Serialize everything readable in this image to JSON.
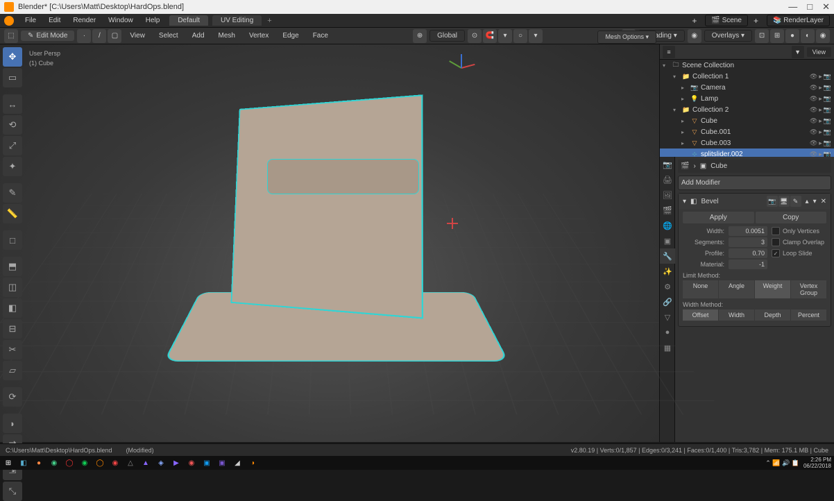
{
  "window": {
    "title": "Blender* [C:\\Users\\Matt\\Desktop\\HardOps.blend]",
    "min": "—",
    "max": "□",
    "close": "✕"
  },
  "topmenu": {
    "items": [
      "File",
      "Edit",
      "Render",
      "Window",
      "Help"
    ],
    "tabs": [
      "Default",
      "UV Editing"
    ],
    "plus": "+",
    "scene_label": "Scene",
    "layer_label": "RenderLayer"
  },
  "header": {
    "mode": "Edit Mode",
    "menus": [
      "View",
      "Select",
      "Add",
      "Mesh",
      "Vertex",
      "Edge",
      "Face"
    ],
    "orientation": "Global",
    "shading": "Shading",
    "overlays": "Overlays",
    "mesh_options": "Mesh Options",
    "view_label": "View"
  },
  "viewport": {
    "persp": "User Persp",
    "object": "(1) Cube"
  },
  "outliner": {
    "filter": "View",
    "root": "Scene Collection",
    "items": [
      {
        "depth": 1,
        "type": "collection",
        "name": "Collection 1",
        "expanded": true
      },
      {
        "depth": 2,
        "type": "camera",
        "name": "Camera"
      },
      {
        "depth": 2,
        "type": "lamp",
        "name": "Lamp"
      },
      {
        "depth": 1,
        "type": "collection",
        "name": "Collection 2",
        "expanded": true
      },
      {
        "depth": 2,
        "type": "mesh",
        "name": "Cube"
      },
      {
        "depth": 2,
        "type": "mesh",
        "name": "Cube.001"
      },
      {
        "depth": 2,
        "type": "mesh",
        "name": "Cube.003"
      },
      {
        "depth": 2,
        "type": "empty",
        "name": "splitslider.002",
        "selected": true
      }
    ]
  },
  "properties": {
    "object_name": "Cube",
    "add_modifier": "Add Modifier",
    "modifier": {
      "name": "Bevel",
      "apply": "Apply",
      "copy": "Copy",
      "width_label": "Width:",
      "width_value": "0.0051",
      "segments_label": "Segments:",
      "segments_value": "3",
      "profile_label": "Profile:",
      "profile_value": "0.70",
      "material_label": "Material:",
      "material_value": "-1",
      "only_vertices": "Only Vertices",
      "clamp_overlap": "Clamp Overlap",
      "loop_slide": "Loop Slide",
      "limit_label": "Limit Method:",
      "limit_opts": [
        "None",
        "Angle",
        "Weight",
        "Vertex Group"
      ],
      "limit_active": "Weight",
      "width_method_label": "Width Method:",
      "width_opts": [
        "Offset",
        "Width",
        "Depth",
        "Percent"
      ],
      "width_active": "Offset"
    }
  },
  "statusbar": {
    "path": "C:\\Users\\Matt\\Desktop\\HardOps.blend",
    "modified": "(Modified)",
    "stats": "v2.80.19 | Verts:0/1,857 | Edges:0/3,241 | Faces:0/1,400 | Tris:3,782 | Mem: 175.1 MB | Cube"
  },
  "taskbar": {
    "icons": [
      "⊞",
      "◧",
      "●",
      "◉",
      "◯",
      "◉",
      "◯",
      "◉",
      "△",
      "▲",
      "◈",
      "▶",
      "◉",
      "▣",
      "▣",
      "◢",
      "◑"
    ],
    "colors": [
      "#fff",
      "#5ac",
      "#f84",
      "#4c8",
      "#e33",
      "#1c5",
      "#f80",
      "#e44",
      "#888",
      "#86f",
      "#8af",
      "#86f",
      "#e55",
      "#19e",
      "#75c",
      "#ccc",
      "#f80"
    ],
    "tray": "⌃ 📶 🔊 📋",
    "time": "2:26 PM",
    "date": "06/22/2018"
  }
}
